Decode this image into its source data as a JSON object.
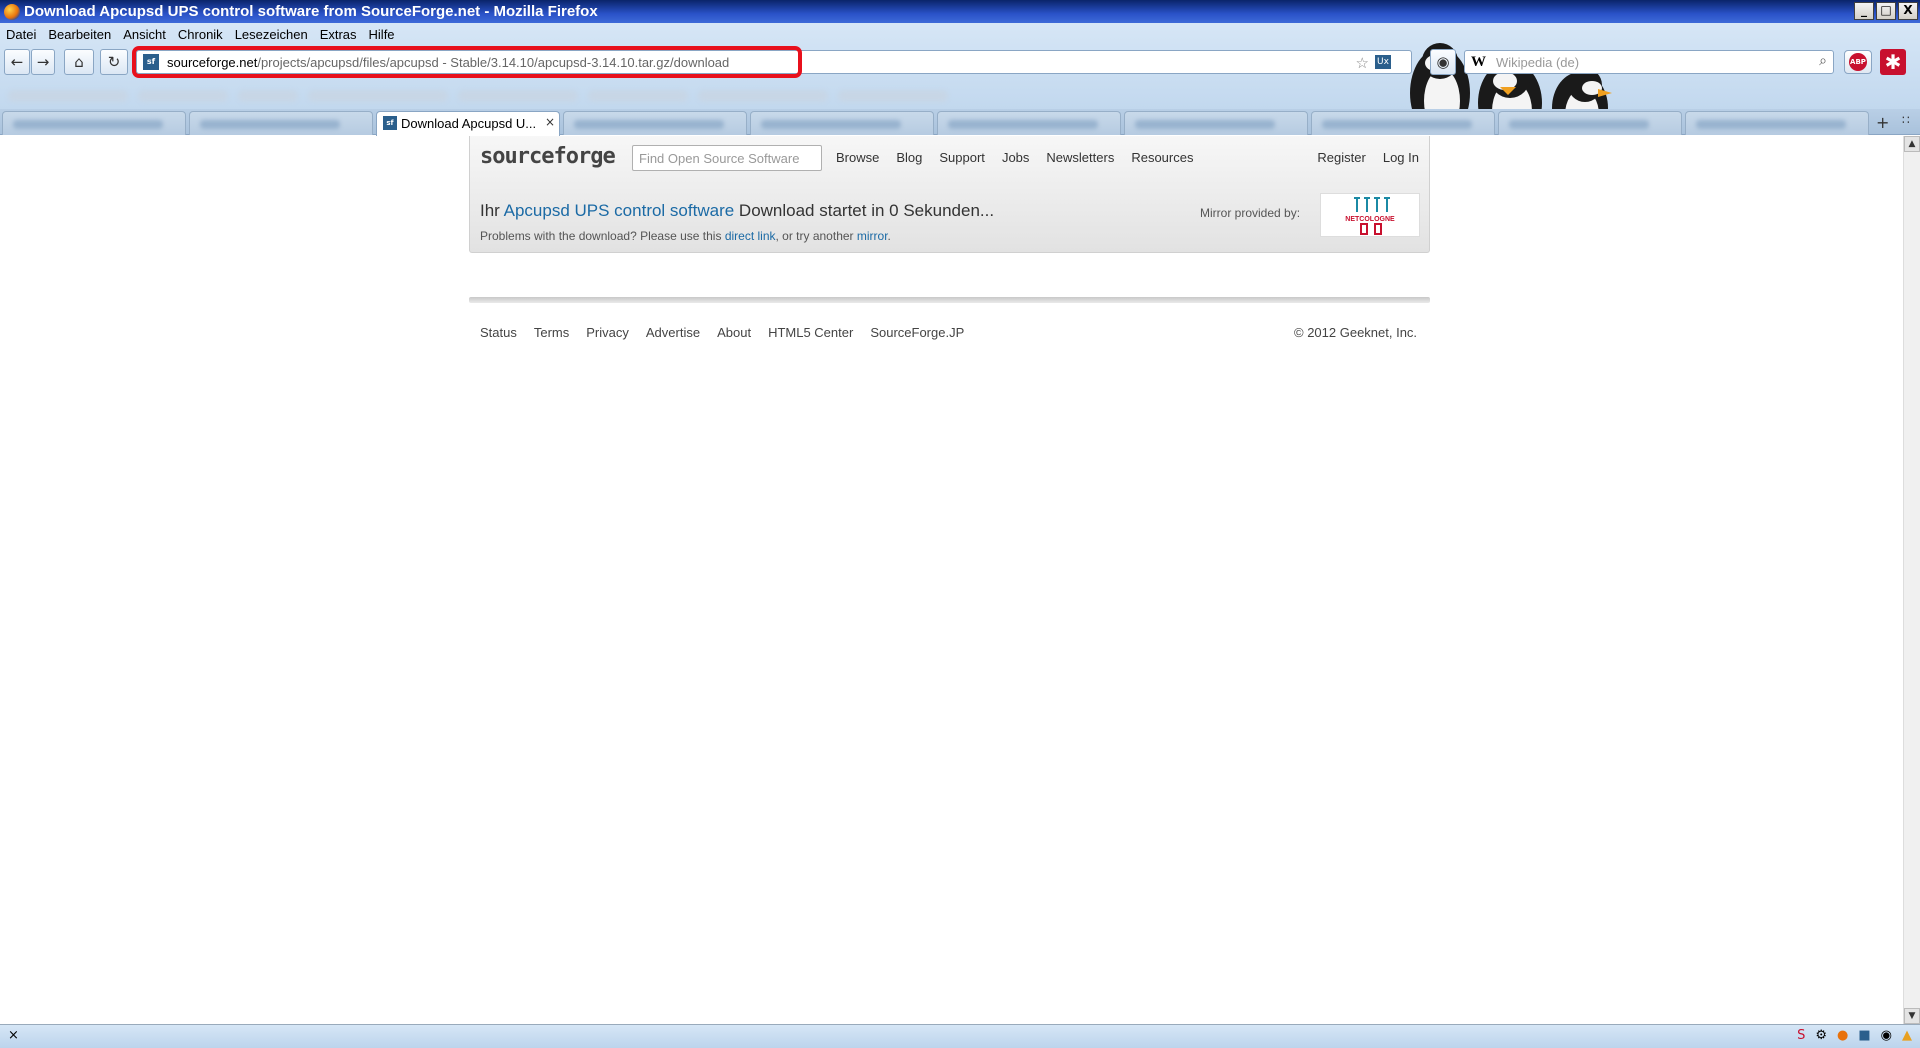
{
  "window": {
    "title": "Download Apcupsd UPS control software from SourceForge.net - Mozilla Firefox",
    "min_label": "_",
    "max_label": "□",
    "close_label": "X"
  },
  "menu": [
    "Datei",
    "Bearbeiten",
    "Ansicht",
    "Chronik",
    "Lesezeichen",
    "Extras",
    "Hilfe"
  ],
  "nav": {
    "back_icon": "←",
    "forward_icon": "→",
    "home_icon": "⌂",
    "reload_icon": "↻",
    "url_domain": "sourceforge.net",
    "url_path": "/projects/apcupsd/files/apcupsd - Stable/3.14.10/apcupsd-3.14.10.tar.gz/download",
    "site_icon": "sf",
    "bookmark_icon": "☆",
    "search_engine": "W",
    "search_placeholder": "Wikipedia (de)",
    "search_go": "⌕",
    "abp_label": "ABP",
    "addon_icon": "✱"
  },
  "tabs": {
    "active_label": "Download Apcupsd U...",
    "close": "×",
    "new_tab": "+",
    "list_all": "∷"
  },
  "sf": {
    "logo": "sourceforge",
    "search_placeholder": "Find Open Source Software",
    "nav": [
      "Browse",
      "Blog",
      "Support",
      "Jobs",
      "Newsletters",
      "Resources"
    ],
    "register": "Register",
    "login": "Log In",
    "msg_prefix": "Ihr ",
    "project_link": "Apcupsd UPS control software",
    "msg_suffix": " Download startet in 0 Sekunden...",
    "problem_prefix": "Problems with the download? Please use this ",
    "direct_link": "direct link",
    "problem_mid": ", or try another ",
    "mirror_link": "mirror",
    "problem_end": ".",
    "mirror_label": "Mirror provided by:",
    "mirror_name": "NETCOLOGNE",
    "footer": [
      "Status",
      "Terms",
      "Privacy",
      "Advertise",
      "About",
      "HTML5 Center",
      "SourceForge.JP"
    ],
    "copyright": "© 2012 Geeknet, Inc."
  },
  "status": {
    "close": "×"
  },
  "colors": {
    "link": "#1b6aa5",
    "highlight": "#e8101c",
    "titlebar": "#0a246a"
  }
}
